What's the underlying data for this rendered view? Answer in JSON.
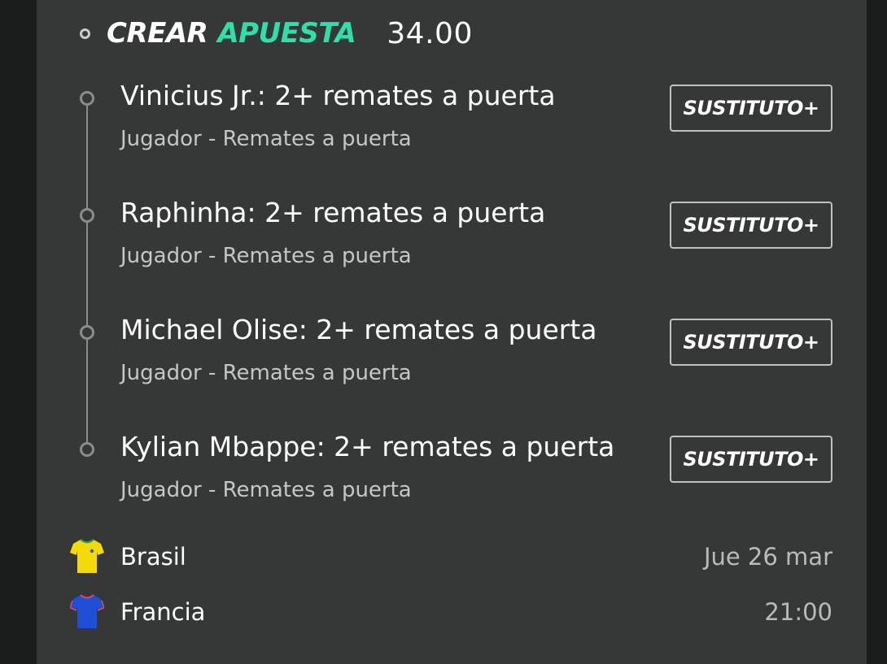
{
  "header": {
    "brand_part1": "CREAR",
    "brand_part2": "APUESTA",
    "odds": "34.00",
    "accent_color": "#2de0a7"
  },
  "legs": [
    {
      "title": "Vinicius Jr.: 2+ remates a puerta",
      "subtitle": "Jugador - Remates a puerta",
      "button": "SUSTITUTO+"
    },
    {
      "title": "Raphinha: 2+ remates a puerta",
      "subtitle": "Jugador - Remates a puerta",
      "button": "SUSTITUTO+"
    },
    {
      "title": "Michael Olise: 2+ remates a puerta",
      "subtitle": "Jugador - Remates a puerta",
      "button": "SUSTITUTO+"
    },
    {
      "title": "Kylian Mbappe: 2+ remates a puerta",
      "subtitle": "Jugador - Remates a puerta",
      "button": "SUSTITUTO+"
    }
  ],
  "match": {
    "home": {
      "name": "Brasil",
      "shirt_icon": "yellow-shirt-icon",
      "shirt_color": "#f5d90a"
    },
    "away": {
      "name": "Francia",
      "shirt_icon": "blue-shirt-icon",
      "shirt_color": "#1f4fd6"
    },
    "date": "Jue 26 mar",
    "time": "21:00"
  }
}
